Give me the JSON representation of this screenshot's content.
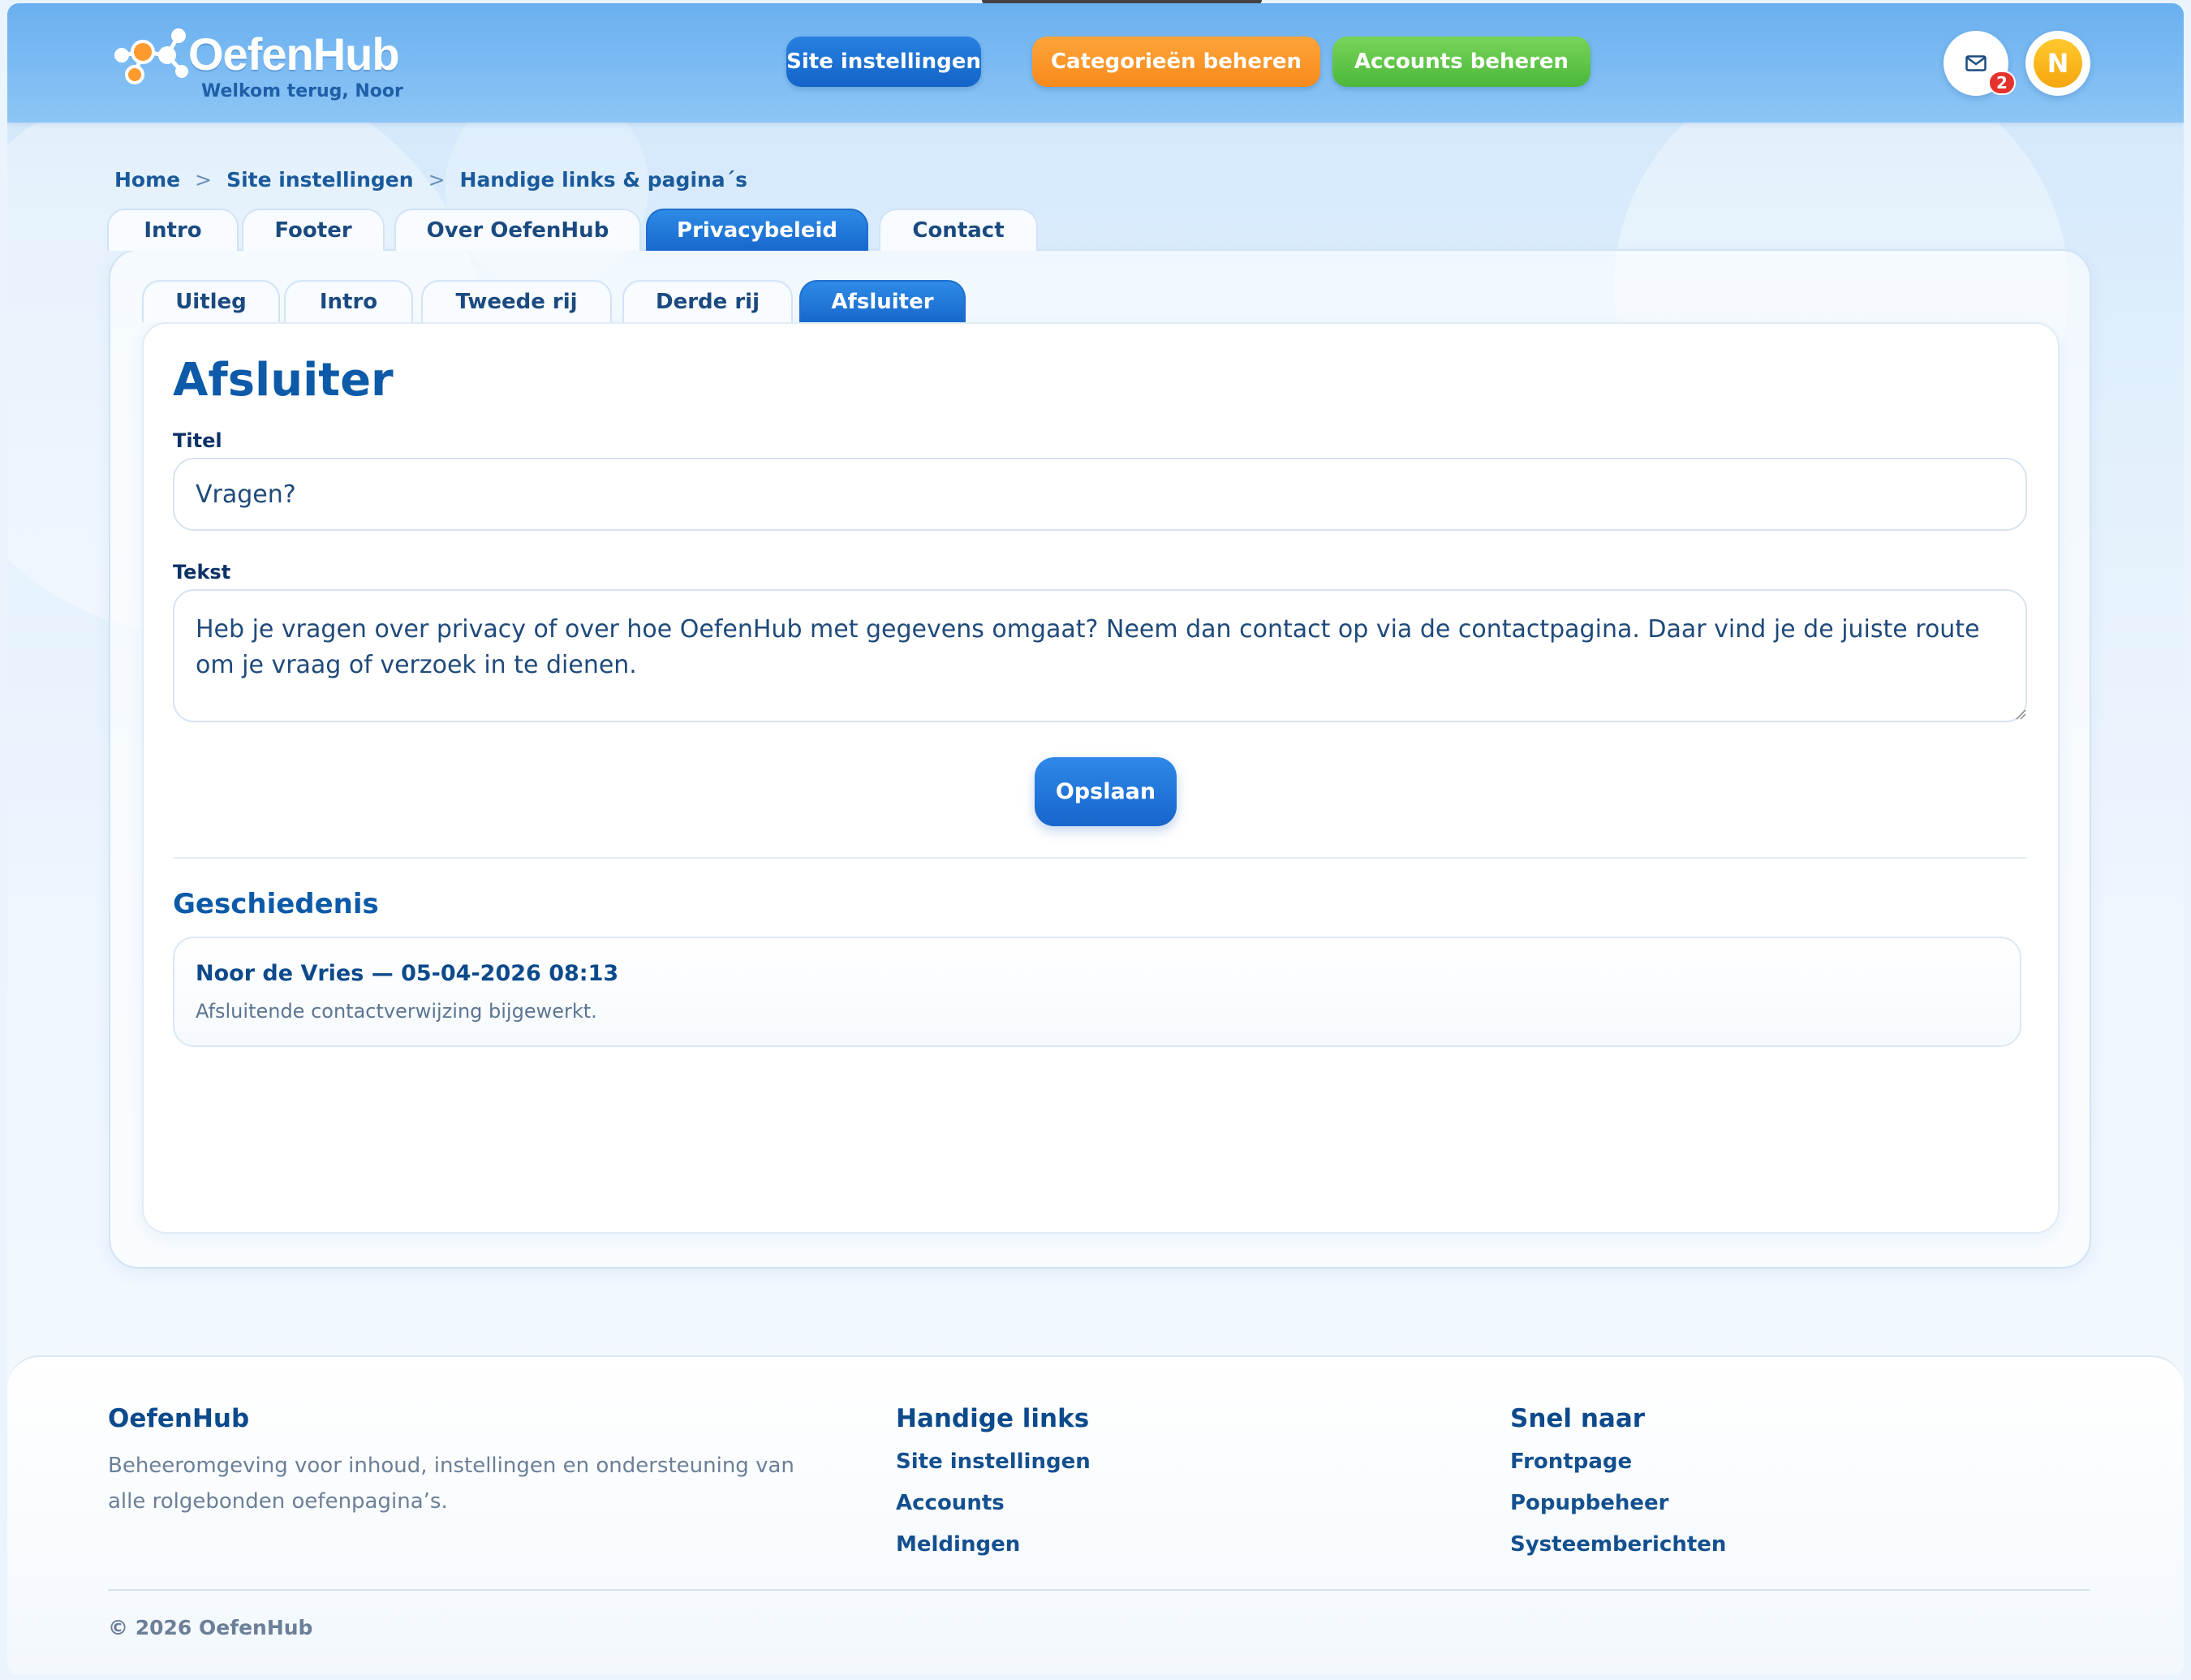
{
  "app": {
    "name": "OefenHub",
    "welcome": "Welkom terug, Noor",
    "avatar_initial": "N",
    "mail_count": "2"
  },
  "nav": {
    "site_settings": "Site instellingen",
    "categories": "Categorieën beheren",
    "accounts": "Accounts beheren"
  },
  "breadcrumb": [
    "Home",
    "Site instellingen",
    "Handige links & pagina´s"
  ],
  "breadcrumb_sep": ">",
  "tabs": [
    "Intro",
    "Footer",
    "Over OefenHub",
    "Privacybeleid",
    "Contact"
  ],
  "active_tab": "Privacybeleid",
  "subtabs": [
    "Uitleg",
    "Intro",
    "Tweede rij",
    "Derde rij",
    "Afsluiter"
  ],
  "active_subtab": "Afsluiter",
  "form": {
    "heading": "Afsluiter",
    "title_label": "Titel",
    "title_value": "Vragen?",
    "text_label": "Tekst",
    "text_value": "Heb je vragen over privacy of over hoe OefenHub met gegevens omgaat? Neem dan contact op via de contactpagina. Daar vind je de juiste route om je vraag of verzoek in te dienen.",
    "save_label": "Opslaan"
  },
  "history": {
    "title": "Geschiedenis",
    "entries": [
      {
        "header": "Noor de Vries — 05-04-2026 08:13",
        "text": "Afsluitende contactverwijzing bijgewerkt."
      }
    ]
  },
  "footer": {
    "col1_title": "OefenHub",
    "col1_desc": "Beheeromgeving voor inhoud, instellingen en ondersteuning van alle rolgebonden oefenpagina’s.",
    "col2_title": "Handige links",
    "col2_links": [
      "Site instellingen",
      "Accounts",
      "Meldingen"
    ],
    "col3_title": "Snel naar",
    "col3_links": [
      "Frontpage",
      "Popupbeheer",
      "Systeemberichten"
    ],
    "copyright": "© 2026 OefenHub"
  },
  "colors": {
    "primary": "#1868cc",
    "orange": "#f78a1c",
    "green": "#4cb83b",
    "badge": "#e5322d",
    "avatar": "#f5a60d"
  }
}
